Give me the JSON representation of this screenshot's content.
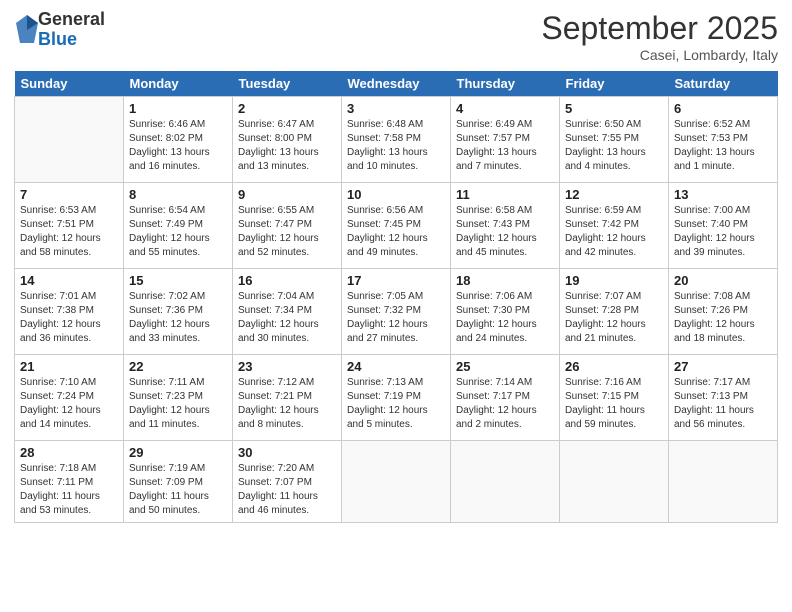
{
  "logo": {
    "general": "General",
    "blue": "Blue"
  },
  "title": "September 2025",
  "location": "Casei, Lombardy, Italy",
  "weekdays": [
    "Sunday",
    "Monday",
    "Tuesday",
    "Wednesday",
    "Thursday",
    "Friday",
    "Saturday"
  ],
  "weeks": [
    [
      {
        "day": null,
        "sunrise": null,
        "sunset": null,
        "daylight": null
      },
      {
        "day": "1",
        "sunrise": "Sunrise: 6:46 AM",
        "sunset": "Sunset: 8:02 PM",
        "daylight": "Daylight: 13 hours and 16 minutes."
      },
      {
        "day": "2",
        "sunrise": "Sunrise: 6:47 AM",
        "sunset": "Sunset: 8:00 PM",
        "daylight": "Daylight: 13 hours and 13 minutes."
      },
      {
        "day": "3",
        "sunrise": "Sunrise: 6:48 AM",
        "sunset": "Sunset: 7:58 PM",
        "daylight": "Daylight: 13 hours and 10 minutes."
      },
      {
        "day": "4",
        "sunrise": "Sunrise: 6:49 AM",
        "sunset": "Sunset: 7:57 PM",
        "daylight": "Daylight: 13 hours and 7 minutes."
      },
      {
        "day": "5",
        "sunrise": "Sunrise: 6:50 AM",
        "sunset": "Sunset: 7:55 PM",
        "daylight": "Daylight: 13 hours and 4 minutes."
      },
      {
        "day": "6",
        "sunrise": "Sunrise: 6:52 AM",
        "sunset": "Sunset: 7:53 PM",
        "daylight": "Daylight: 13 hours and 1 minute."
      }
    ],
    [
      {
        "day": "7",
        "sunrise": "Sunrise: 6:53 AM",
        "sunset": "Sunset: 7:51 PM",
        "daylight": "Daylight: 12 hours and 58 minutes."
      },
      {
        "day": "8",
        "sunrise": "Sunrise: 6:54 AM",
        "sunset": "Sunset: 7:49 PM",
        "daylight": "Daylight: 12 hours and 55 minutes."
      },
      {
        "day": "9",
        "sunrise": "Sunrise: 6:55 AM",
        "sunset": "Sunset: 7:47 PM",
        "daylight": "Daylight: 12 hours and 52 minutes."
      },
      {
        "day": "10",
        "sunrise": "Sunrise: 6:56 AM",
        "sunset": "Sunset: 7:45 PM",
        "daylight": "Daylight: 12 hours and 49 minutes."
      },
      {
        "day": "11",
        "sunrise": "Sunrise: 6:58 AM",
        "sunset": "Sunset: 7:43 PM",
        "daylight": "Daylight: 12 hours and 45 minutes."
      },
      {
        "day": "12",
        "sunrise": "Sunrise: 6:59 AM",
        "sunset": "Sunset: 7:42 PM",
        "daylight": "Daylight: 12 hours and 42 minutes."
      },
      {
        "day": "13",
        "sunrise": "Sunrise: 7:00 AM",
        "sunset": "Sunset: 7:40 PM",
        "daylight": "Daylight: 12 hours and 39 minutes."
      }
    ],
    [
      {
        "day": "14",
        "sunrise": "Sunrise: 7:01 AM",
        "sunset": "Sunset: 7:38 PM",
        "daylight": "Daylight: 12 hours and 36 minutes."
      },
      {
        "day": "15",
        "sunrise": "Sunrise: 7:02 AM",
        "sunset": "Sunset: 7:36 PM",
        "daylight": "Daylight: 12 hours and 33 minutes."
      },
      {
        "day": "16",
        "sunrise": "Sunrise: 7:04 AM",
        "sunset": "Sunset: 7:34 PM",
        "daylight": "Daylight: 12 hours and 30 minutes."
      },
      {
        "day": "17",
        "sunrise": "Sunrise: 7:05 AM",
        "sunset": "Sunset: 7:32 PM",
        "daylight": "Daylight: 12 hours and 27 minutes."
      },
      {
        "day": "18",
        "sunrise": "Sunrise: 7:06 AM",
        "sunset": "Sunset: 7:30 PM",
        "daylight": "Daylight: 12 hours and 24 minutes."
      },
      {
        "day": "19",
        "sunrise": "Sunrise: 7:07 AM",
        "sunset": "Sunset: 7:28 PM",
        "daylight": "Daylight: 12 hours and 21 minutes."
      },
      {
        "day": "20",
        "sunrise": "Sunrise: 7:08 AM",
        "sunset": "Sunset: 7:26 PM",
        "daylight": "Daylight: 12 hours and 18 minutes."
      }
    ],
    [
      {
        "day": "21",
        "sunrise": "Sunrise: 7:10 AM",
        "sunset": "Sunset: 7:24 PM",
        "daylight": "Daylight: 12 hours and 14 minutes."
      },
      {
        "day": "22",
        "sunrise": "Sunrise: 7:11 AM",
        "sunset": "Sunset: 7:23 PM",
        "daylight": "Daylight: 12 hours and 11 minutes."
      },
      {
        "day": "23",
        "sunrise": "Sunrise: 7:12 AM",
        "sunset": "Sunset: 7:21 PM",
        "daylight": "Daylight: 12 hours and 8 minutes."
      },
      {
        "day": "24",
        "sunrise": "Sunrise: 7:13 AM",
        "sunset": "Sunset: 7:19 PM",
        "daylight": "Daylight: 12 hours and 5 minutes."
      },
      {
        "day": "25",
        "sunrise": "Sunrise: 7:14 AM",
        "sunset": "Sunset: 7:17 PM",
        "daylight": "Daylight: 12 hours and 2 minutes."
      },
      {
        "day": "26",
        "sunrise": "Sunrise: 7:16 AM",
        "sunset": "Sunset: 7:15 PM",
        "daylight": "Daylight: 11 hours and 59 minutes."
      },
      {
        "day": "27",
        "sunrise": "Sunrise: 7:17 AM",
        "sunset": "Sunset: 7:13 PM",
        "daylight": "Daylight: 11 hours and 56 minutes."
      }
    ],
    [
      {
        "day": "28",
        "sunrise": "Sunrise: 7:18 AM",
        "sunset": "Sunset: 7:11 PM",
        "daylight": "Daylight: 11 hours and 53 minutes."
      },
      {
        "day": "29",
        "sunrise": "Sunrise: 7:19 AM",
        "sunset": "Sunset: 7:09 PM",
        "daylight": "Daylight: 11 hours and 50 minutes."
      },
      {
        "day": "30",
        "sunrise": "Sunrise: 7:20 AM",
        "sunset": "Sunset: 7:07 PM",
        "daylight": "Daylight: 11 hours and 46 minutes."
      },
      {
        "day": null,
        "sunrise": null,
        "sunset": null,
        "daylight": null
      },
      {
        "day": null,
        "sunrise": null,
        "sunset": null,
        "daylight": null
      },
      {
        "day": null,
        "sunrise": null,
        "sunset": null,
        "daylight": null
      },
      {
        "day": null,
        "sunrise": null,
        "sunset": null,
        "daylight": null
      }
    ]
  ]
}
